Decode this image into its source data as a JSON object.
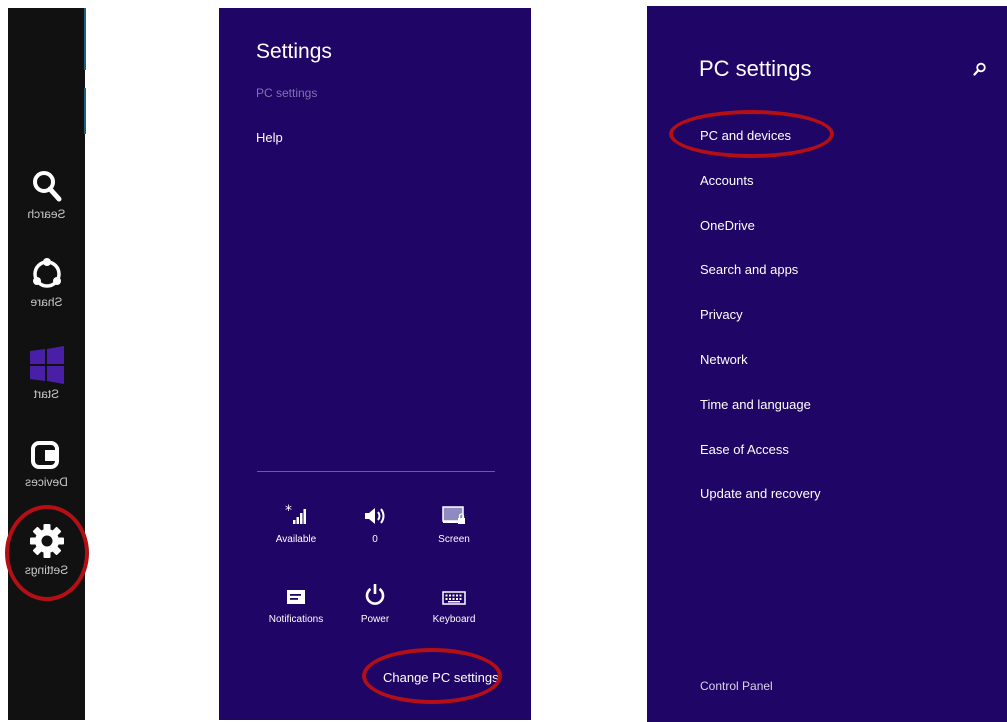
{
  "charms": {
    "items": [
      {
        "label": "Search",
        "icon": "search-icon"
      },
      {
        "label": "Share",
        "icon": "share-icon"
      },
      {
        "label": "Start",
        "icon": "windows-logo-icon"
      },
      {
        "label": "Devices",
        "icon": "devices-icon"
      },
      {
        "label": "Settings",
        "icon": "gear-icon"
      }
    ]
  },
  "settings_pane": {
    "title": "Settings",
    "subtitle": "PC settings",
    "help": "Help",
    "quick_tiles": [
      {
        "label": "Available",
        "icon": "network-signal-icon"
      },
      {
        "label": "0",
        "icon": "volume-icon"
      },
      {
        "label": "Screen",
        "icon": "screen-icon"
      },
      {
        "label": "Notifications",
        "icon": "notifications-icon"
      },
      {
        "label": "Power",
        "icon": "power-icon"
      },
      {
        "label": "Keyboard",
        "icon": "keyboard-icon"
      }
    ],
    "change_pc_settings": "Change PC settings"
  },
  "pc_settings": {
    "title": "PC settings",
    "nav": [
      "PC and devices",
      "Accounts",
      "OneDrive",
      "Search and apps",
      "Privacy",
      "Network",
      "Time and language",
      "Ease of Access",
      "Update and recovery"
    ],
    "control_panel": "Control Panel"
  },
  "colors": {
    "charms_bg": "#111111",
    "pane_bg": "#1f0565",
    "highlight_circle": "#b30f14",
    "start_tile": "#4a1fa8"
  }
}
